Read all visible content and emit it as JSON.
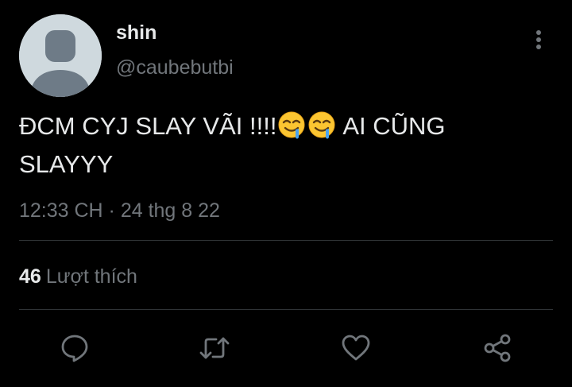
{
  "tweet": {
    "author": {
      "display_name": "shin",
      "handle": "@caubebutbi"
    },
    "text_part1": "ĐCM CYJ SLAY VÃI !!!!",
    "text_part2": " AI CŨNG SLAYYY",
    "emojis": [
      "drooling-face-emoji",
      "drooling-face-emoji"
    ],
    "timestamp": "12:33 CH · 24 thg 8 22",
    "likes": {
      "count": "46",
      "label": "Lượt thích"
    }
  },
  "icons": {
    "more": "more-vertical-icon",
    "reply": "reply-icon",
    "retweet": "retweet-icon",
    "like": "heart-icon",
    "share": "share-icon"
  },
  "colors": {
    "background": "#000000",
    "text_primary": "#e7e9ea",
    "text_secondary": "#71767b",
    "divider": "#2f3336",
    "avatar_bg": "#cfd9de",
    "avatar_fg": "#6e7b87"
  }
}
